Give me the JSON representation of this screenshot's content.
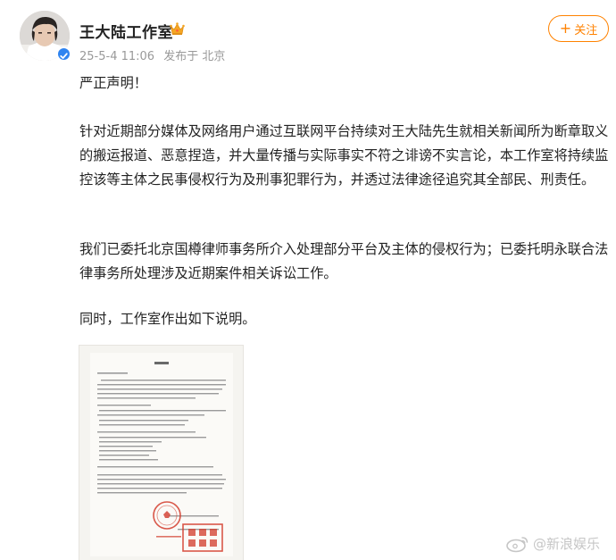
{
  "header": {
    "username": "王大陆工作室",
    "timestamp": "25-5-4 11:06",
    "source": "发布于 北京",
    "follow_label": "关注",
    "follow_plus": "+",
    "verified_icon": "verified-badge-icon",
    "crown_icon": "crown-icon"
  },
  "post": {
    "paragraph1": "严正声明！",
    "paragraph2": "针对近期部分媒体及网络用户通过互联网平台持续对王大陆先生就相关新闻所为断章取义的搬运报道、恶意捏造，并大量传播与实际事实不符之诽谤不实言论，本工作室将持续监控该等主体之民事侵权行为及刑事犯罪行为，并透过法律途径追究其全部民、刑责任。",
    "paragraph3": "我们已委托北京国樽律师事务所介入处理部分平台及主体的侵权行为；已委托明永联合法律事务所处理涉及近期案件相关诉讼工作。",
    "paragraph4": "同时，工作室作出如下说明。"
  },
  "watermark": {
    "text": "@新浪娱乐"
  },
  "colors": {
    "accent": "#ff8200",
    "verified": "#2f84f0",
    "meta": "#999999",
    "stamp": "#d23a2a"
  }
}
